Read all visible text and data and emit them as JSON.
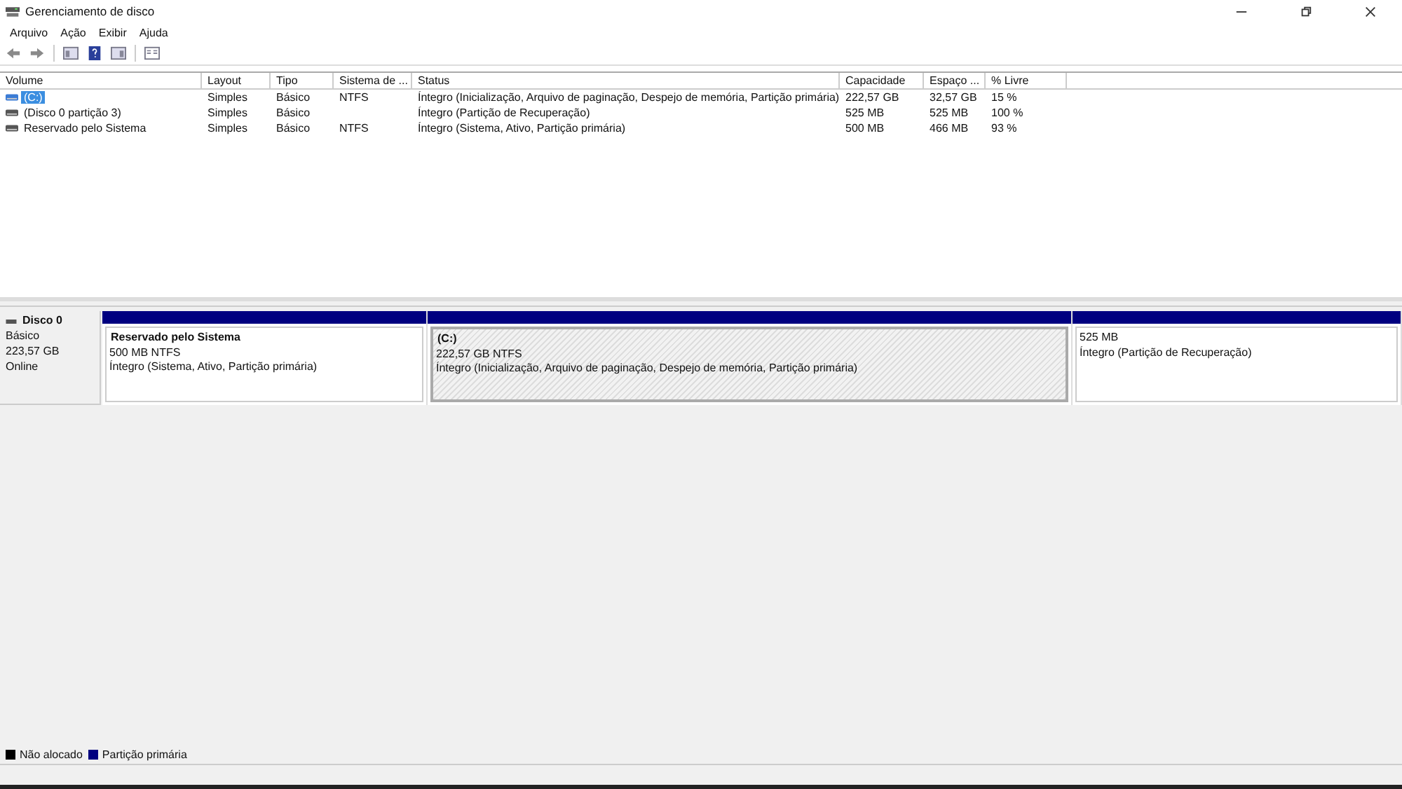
{
  "window": {
    "title": "Gerenciamento de disco"
  },
  "menu": [
    "Arquivo",
    "Ação",
    "Exibir",
    "Ajuda"
  ],
  "table": {
    "columns": [
      "Volume",
      "Layout",
      "Tipo",
      "Sistema de ...",
      "Status",
      "Capacidade",
      "Espaço ...",
      "% Livre"
    ],
    "rows": [
      {
        "selected": true,
        "cells": [
          "(C:)",
          "Simples",
          "Básico",
          "NTFS",
          "Íntegro (Inicialização, Arquivo de paginação, Despejo de memória, Partição primária)",
          "222,57 GB",
          "32,57 GB",
          "15 %"
        ]
      },
      {
        "selected": false,
        "cells": [
          "(Disco 0 partição 3)",
          "Simples",
          "Básico",
          "",
          "Íntegro (Partição de Recuperação)",
          "525 MB",
          "525 MB",
          "100 %"
        ]
      },
      {
        "selected": false,
        "cells": [
          "Reservado pelo Sistema",
          "Simples",
          "Básico",
          "NTFS",
          "Íntegro (Sistema, Ativo, Partição primária)",
          "500 MB",
          "466 MB",
          "93 %"
        ]
      }
    ]
  },
  "disk": {
    "name": "Disco 0",
    "type": "Básico",
    "size": "223,57 GB",
    "state": "Online",
    "partitions": [
      {
        "name": "Reservado pelo Sistema",
        "size": "500 MB NTFS",
        "status": "Íntegro (Sistema, Ativo, Partição primária)",
        "selected": false,
        "color": "#000080"
      },
      {
        "name": "(C:)",
        "size": "222,57 GB NTFS",
        "status": "Íntegro (Inicialização, Arquivo de paginação, Despejo de memória, Partição primária)",
        "selected": true,
        "color": "#000080"
      },
      {
        "size": "525 MB",
        "status": "Íntegro (Partição de Recuperação)",
        "selected": false,
        "color": "#000080"
      }
    ]
  },
  "legend": [
    {
      "label": "Não alocado",
      "color": "#000000"
    },
    {
      "label": "Partição primária",
      "color": "#000080"
    }
  ]
}
